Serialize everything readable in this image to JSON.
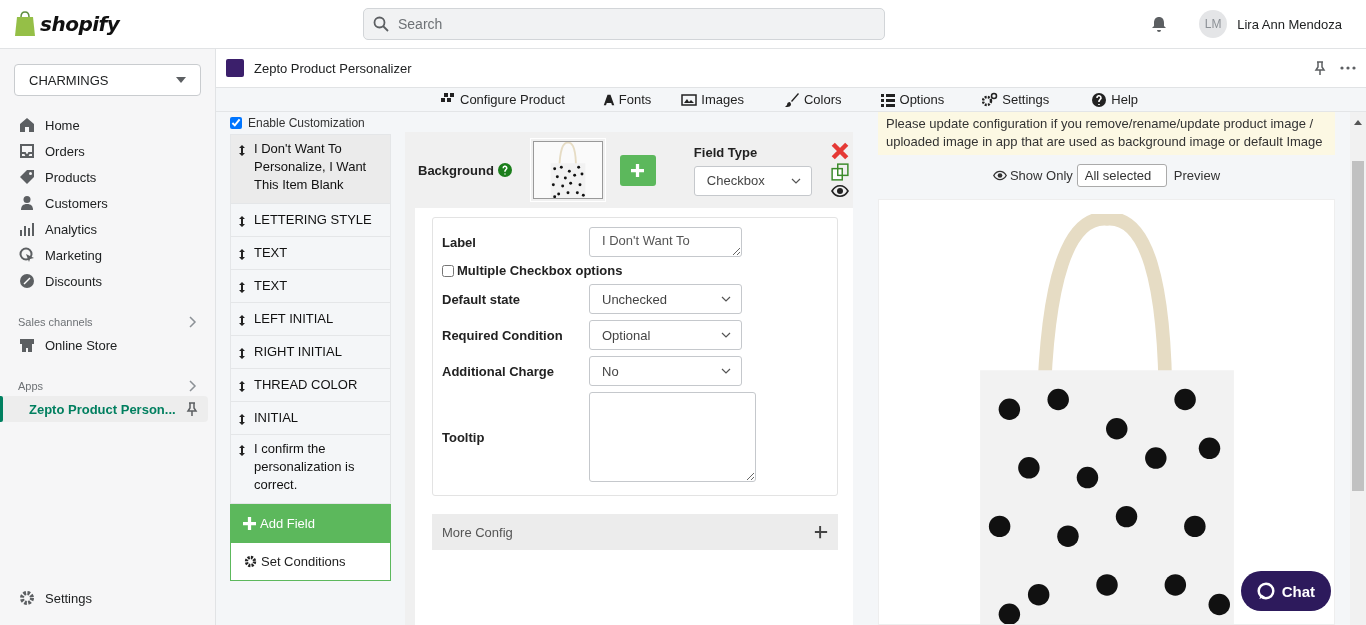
{
  "topbar": {
    "logo": "shopify",
    "search": {
      "placeholder": "Search"
    },
    "user": {
      "initials": "LM",
      "name": "Lira Ann Mendoza"
    }
  },
  "sidebar": {
    "store": "CHARMINGS",
    "items": [
      {
        "label": "Home",
        "selected": false
      },
      {
        "label": "Orders",
        "selected": false
      },
      {
        "label": "Products",
        "selected": false
      },
      {
        "label": "Customers",
        "selected": false
      },
      {
        "label": "Analytics",
        "selected": false
      },
      {
        "label": "Marketing",
        "selected": false
      },
      {
        "label": "Discounts",
        "selected": false
      }
    ],
    "sales_channels": {
      "heading": "Sales channels",
      "items": [
        {
          "label": "Online Store",
          "selected": false
        }
      ]
    },
    "apps": {
      "heading": "Apps",
      "items": [
        {
          "label": "Zepto Product Person...",
          "selected": true
        }
      ]
    },
    "settings": "Settings"
  },
  "app": {
    "title": "Zepto Product Personalizer",
    "toolbar": [
      {
        "label": "Configure Product",
        "selected": false
      },
      {
        "label": "Fonts",
        "selected": false
      },
      {
        "label": "Images",
        "selected": false
      },
      {
        "label": "Colors",
        "selected": false
      },
      {
        "label": "Options",
        "selected": false
      },
      {
        "label": "Settings",
        "selected": false
      },
      {
        "label": "Help",
        "selected": false
      }
    ],
    "enable_customization": {
      "label": "Enable Customization",
      "checked": true
    },
    "fields": [
      {
        "label": "I Don't Want To Personalize, I Want This Item Blank",
        "selected": true
      },
      {
        "label": "LETTERING STYLE",
        "selected": false
      },
      {
        "label": "TEXT",
        "selected": false
      },
      {
        "label": "TEXT",
        "selected": false
      },
      {
        "label": "LEFT INITIAL",
        "selected": false
      },
      {
        "label": "RIGHT INITIAL",
        "selected": false
      },
      {
        "label": "THREAD COLOR",
        "selected": false
      },
      {
        "label": "INITIAL",
        "selected": false
      },
      {
        "label": "I confirm the personalization is correct.",
        "selected": false
      }
    ],
    "add_field": "Add Field",
    "set_conditions": "Set Conditions",
    "editor": {
      "background_label": "Background",
      "field_type": {
        "label": "Field Type",
        "value": "Checkbox"
      },
      "rows": [
        {
          "kind": "textarea",
          "label": "Label",
          "value": "I Don't Want To"
        },
        {
          "kind": "checkbox",
          "label": "Multiple Checkbox options",
          "checked": false
        },
        {
          "kind": "select",
          "label": "Default state",
          "value": "Unchecked"
        },
        {
          "kind": "select",
          "label": "Required Condition",
          "value": "Optional"
        },
        {
          "kind": "select",
          "label": "Additional Charge",
          "value": "No"
        },
        {
          "kind": "bigtext",
          "label": "Tooltip"
        }
      ],
      "more_config": "More Config"
    },
    "notice": "Please update configuration if you remove/rename/update product image / uploaded image in app that are used as background image or default Image",
    "preview": {
      "show_only": "Show Only",
      "filter": "All selected",
      "preview_label": "Preview"
    },
    "chat": "Chat"
  }
}
